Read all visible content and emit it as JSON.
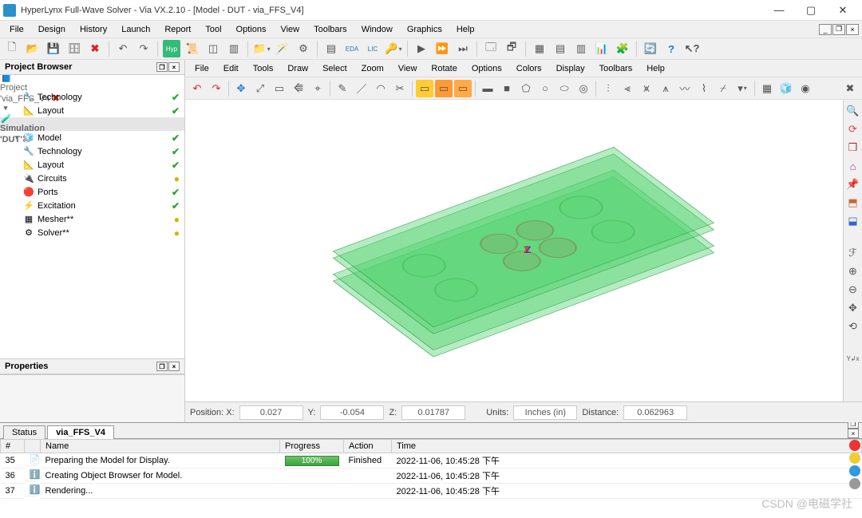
{
  "title": "HyperLynx Full-Wave Solver - Via VX.2.10 - [Model - DUT - via_FFS_V4]",
  "menubar": [
    "File",
    "Design",
    "History",
    "Launch",
    "Report",
    "Tool",
    "Options",
    "View",
    "Toolbars",
    "Window",
    "Graphics",
    "Help"
  ],
  "project_browser": {
    "title": "Project Browser",
    "items": [
      {
        "indent": 0,
        "tw": "▾",
        "icon": "📘",
        "label": "Project 'via_FFS_V4'",
        "status": "err"
      },
      {
        "indent": 1,
        "tw": "",
        "icon": "🔧",
        "label": "Technology",
        "status": "ok"
      },
      {
        "indent": 1,
        "tw": "",
        "icon": "📐",
        "label": "Layout",
        "status": "ok"
      },
      {
        "indent": 0,
        "tw": "▾",
        "icon": "🧪",
        "label": "Simulation 'DUT'",
        "status": "err",
        "sel": true
      },
      {
        "indent": 1,
        "tw": "▾",
        "icon": "🧊",
        "label": "Model",
        "status": "ok"
      },
      {
        "indent": 2,
        "tw": "",
        "icon": "🔧",
        "label": "Technology",
        "status": "ok"
      },
      {
        "indent": 2,
        "tw": "",
        "icon": "📐",
        "label": "Layout",
        "status": "ok"
      },
      {
        "indent": 2,
        "tw": "",
        "icon": "🔌",
        "label": "Circuits",
        "status": "warn"
      },
      {
        "indent": 2,
        "tw": "",
        "icon": "🔴",
        "label": "Ports",
        "status": "ok"
      },
      {
        "indent": 1,
        "tw": "",
        "icon": "⚡",
        "label": "Excitation",
        "status": "ok"
      },
      {
        "indent": 1,
        "tw": "",
        "icon": "▦",
        "label": "Mesher**",
        "status": "warn"
      },
      {
        "indent": 1,
        "tw": "",
        "icon": "⚙",
        "label": "Solver**",
        "status": "warn"
      }
    ]
  },
  "properties": {
    "title": "Properties"
  },
  "editor_menubar": [
    "File",
    "Edit",
    "Tools",
    "Draw",
    "Select",
    "Zoom",
    "View",
    "Rotate",
    "Options",
    "Colors",
    "Display",
    "Toolbars",
    "Help"
  ],
  "statusbar": {
    "posx_lbl": "Position: X:",
    "posx": "0.027",
    "y_lbl": "Y:",
    "y": "-0.054",
    "z_lbl": "Z:",
    "z": "0.01787",
    "units_lbl": "Units:",
    "units": "Inches (in)",
    "dist_lbl": "Distance:",
    "dist": "0.062963"
  },
  "axes": {
    "x": "X",
    "y": "Y",
    "z": "Z"
  },
  "bottom": {
    "tabs": [
      "Status",
      "via_FFS_V4"
    ],
    "active": 1,
    "cols": [
      "#",
      "",
      "Name",
      "Progress",
      "Action",
      "Time"
    ],
    "rows": [
      {
        "n": "35",
        "icon": "📄",
        "name": "Preparing the Model for Display.",
        "progress": "100%",
        "action": "Finished",
        "time": "2022-11-06, 10:45:28 下午"
      },
      {
        "n": "36",
        "icon": "ℹ️",
        "name": "Creating Object Browser for Model.",
        "progress": "",
        "action": "",
        "time": "2022-11-06, 10:45:28 下午"
      },
      {
        "n": "37",
        "icon": "ℹ️",
        "name": "Rendering...",
        "progress": "",
        "action": "",
        "time": "2022-11-06, 10:45:28 下午"
      }
    ]
  },
  "watermark": "CSDN @电磁学社"
}
